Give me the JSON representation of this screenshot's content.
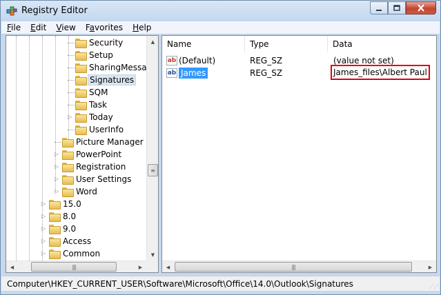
{
  "window": {
    "title": "Registry Editor"
  },
  "menu": [
    "File",
    "Edit",
    "View",
    "Favorites",
    "Help"
  ],
  "menu_underline": [
    "F",
    "E",
    "V",
    "a",
    "H"
  ],
  "tree": {
    "items": [
      {
        "label": "Security",
        "expander": false
      },
      {
        "label": "Setup",
        "expander": false
      },
      {
        "label": "SharingMessag",
        "expander": false
      },
      {
        "label": "Signatures",
        "expander": false,
        "selected": true
      },
      {
        "label": "SQM",
        "expander": false
      },
      {
        "label": "Task",
        "expander": false
      },
      {
        "label": "Today",
        "expander": true
      },
      {
        "label": "UserInfo",
        "expander": false
      },
      {
        "label": "Picture Manager",
        "expander": false
      },
      {
        "label": "PowerPoint",
        "expander": true
      },
      {
        "label": "Registration",
        "expander": true
      },
      {
        "label": "User Settings",
        "expander": true
      },
      {
        "label": "Word",
        "expander": true
      },
      {
        "label": "15.0",
        "expander": true
      },
      {
        "label": "8.0",
        "expander": true
      },
      {
        "label": "9.0",
        "expander": true
      },
      {
        "label": "Access",
        "expander": true
      },
      {
        "label": "Common",
        "expander": true
      }
    ]
  },
  "list": {
    "columns": [
      "Name",
      "Type",
      "Data"
    ],
    "rows": [
      {
        "name": "(Default)",
        "type": "REG_SZ",
        "data": "(value not set)"
      },
      {
        "name": "James",
        "type": "REG_SZ",
        "data": "James_files\\Albert Paul"
      }
    ]
  },
  "status": {
    "path": "Computer\\HKEY_CURRENT_USER\\Software\\Microsoft\\Office\\14.0\\Outlook\\Signatures"
  },
  "icons": {
    "app": "registry-editor-icon",
    "string_value": "string-value-icon",
    "folder": "folder-icon"
  },
  "colors": {
    "selection": "#3399ff",
    "highlight_box": "#e1000f"
  }
}
